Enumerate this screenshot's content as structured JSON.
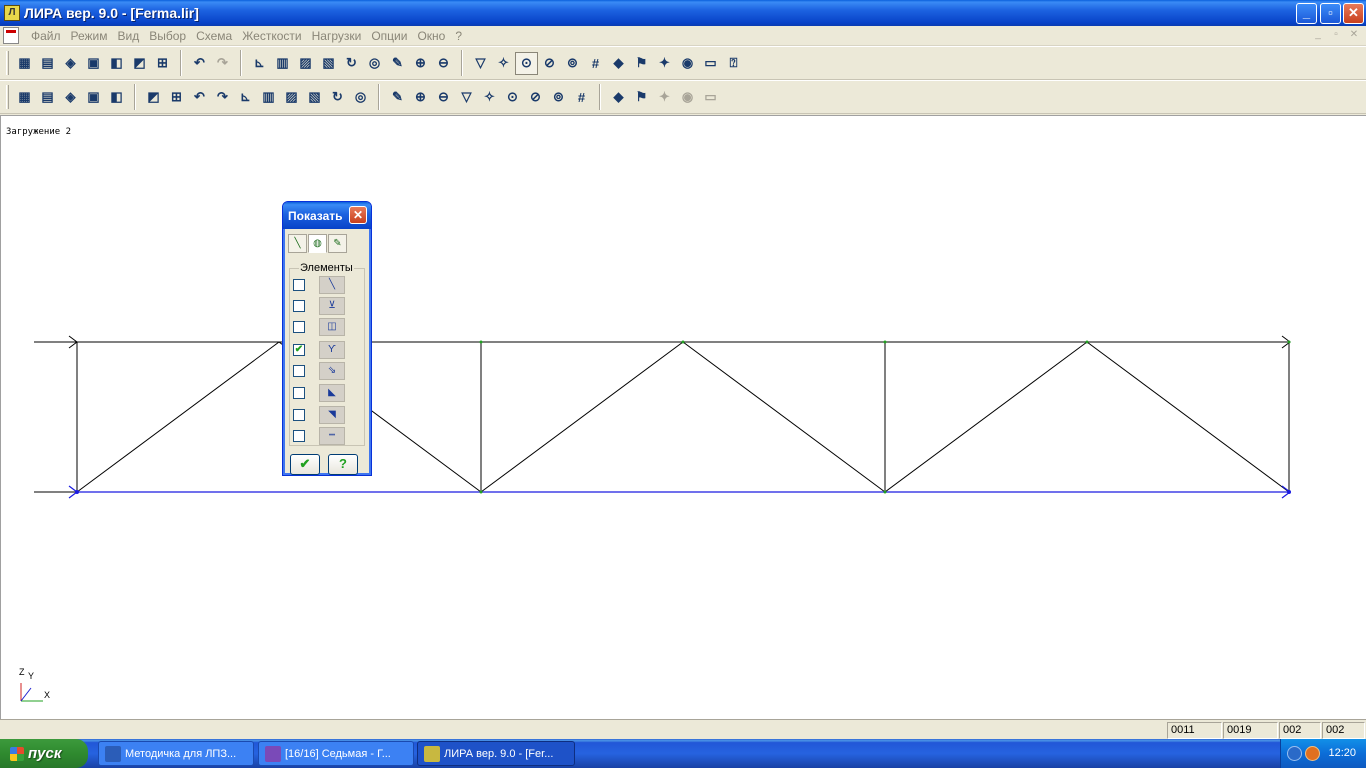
{
  "window": {
    "title": "ЛИРА  вер. 9.0 - [Ferma.lir]",
    "app_icon": "lira-app-icon",
    "controls": [
      "minimize-icon",
      "restore-icon",
      "close-icon"
    ]
  },
  "menu": {
    "items": [
      "Файл",
      "Режим",
      "Вид",
      "Выбор",
      "Схема",
      "Жесткости",
      "Нагрузки",
      "Опции",
      "Окно",
      "?"
    ]
  },
  "toolbar1": {
    "icons": [
      "new-icon",
      "open-icon",
      "save-icon",
      "print-icon",
      "preview-icon",
      "info-icon",
      "export-icon",
      "undo-icon",
      "redo-icon",
      "axes-icon",
      "xz-plane-icon",
      "xy-plane-icon",
      "yz-plane-icon",
      "rotate-icon",
      "node-icon",
      "pencil-icon",
      "zoom-in-icon",
      "zoom-out-icon",
      "filter-icon",
      "select-icon",
      "zoom-window-icon",
      "zoom-minus-icon",
      "zoom-plus-icon",
      "grid-icon",
      "bottle-icon",
      "flag-icon",
      "highlight-icon",
      "camera-icon",
      "page-icon",
      "help-cursor-icon"
    ],
    "pressed_index": 20,
    "dim_indices": [
      8
    ]
  },
  "toolbar2": {
    "icons": [
      "bridge-icon",
      "columns-icon",
      "cylinder-icon",
      "rotate-3d-icon",
      "mirror-icon",
      "cut-icon",
      "package-icon",
      "triangle-icon",
      "star-icon",
      "copy-icon",
      "paste-icon",
      "split-icon",
      "hinge-icon",
      "pin-icon",
      "support-icon",
      "wave-load-icon",
      "node-load-icon",
      "cross-icon",
      "move-icon",
      "force-icon",
      "joint-icon",
      "rigid-icon",
      "fixity-icon",
      "link-icon",
      "cluster-icon",
      "stack-icon",
      "cluster-dim-icon",
      "cluster-dim2-icon",
      "cluster-dim3-icon"
    ],
    "dim_indices": [
      26,
      27,
      28
    ]
  },
  "canvas": {
    "load_case_label": "Загружение 2",
    "axes": {
      "z": "Z",
      "y": "Y",
      "x": "X"
    }
  },
  "dialog": {
    "title": "Показать",
    "tabs": [
      "bar-tab-icon",
      "node-tab-icon",
      "load-tab-icon"
    ],
    "group_label": "Элементы",
    "rows": [
      {
        "checked": false,
        "icon": "bar-element-icon"
      },
      {
        "checked": false,
        "icon": "bar-number-icon"
      },
      {
        "checked": false,
        "icon": "section-icon"
      },
      {
        "checked": true,
        "icon": "hinge-element-icon"
      },
      {
        "checked": false,
        "icon": "local-axes-icon"
      },
      {
        "checked": false,
        "icon": "rigid-insert-icon"
      },
      {
        "checked": false,
        "icon": "orientation-icon"
      },
      {
        "checked": false,
        "icon": "length-icon"
      }
    ],
    "ok_icon": "apply-icon",
    "help_label": "?"
  },
  "status": {
    "cells": [
      "0011",
      "0019",
      "002",
      "002"
    ]
  },
  "taskbar": {
    "start_label": "пуск",
    "tasks": [
      {
        "label": "Методичка для ЛПЗ...",
        "icon": "word-icon",
        "color": "#2B5DB8"
      },
      {
        "label": "[16/16] Седьмая - Г...",
        "icon": "media-icon",
        "color": "#7A4AB8"
      },
      {
        "label": "ЛИРА  вер. 9.0 - [Fer...",
        "icon": "lira-task-icon",
        "color": "#C8B840"
      }
    ],
    "active_index": 2,
    "clock": "12:20"
  }
}
